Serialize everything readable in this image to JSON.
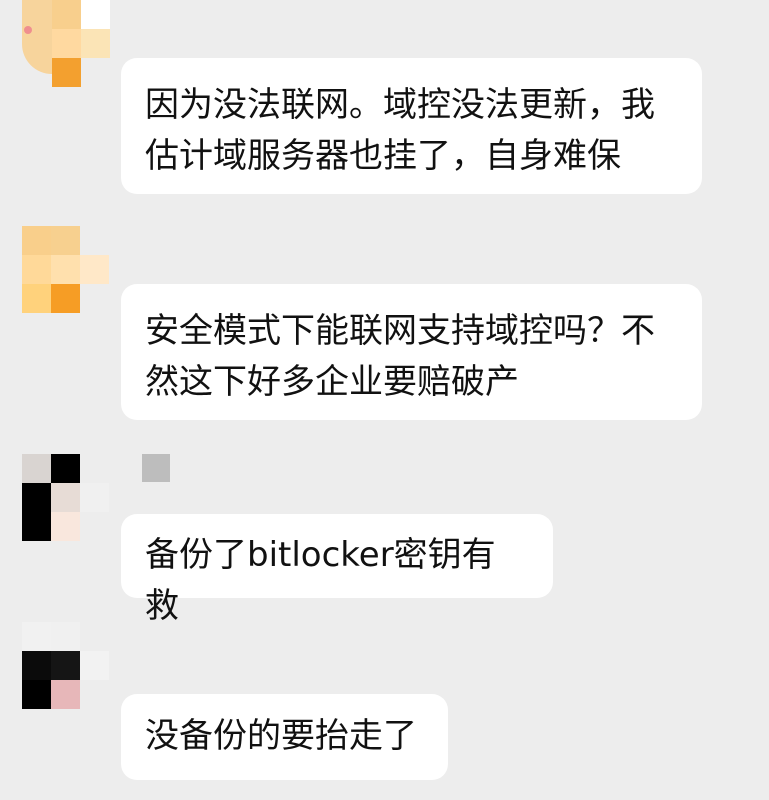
{
  "messages": [
    {
      "text": "因为没法联网。域控没法更新，我估计域服务器也挂了，自身难保"
    },
    {
      "text": "安全模式下能联网支持域控吗？不然这下好多企业要赔破产"
    },
    {
      "text": "备份了bitlocker密钥有救"
    },
    {
      "text": "没备份的要抬走了"
    }
  ],
  "colors": {
    "background": "#ededed",
    "bubble": "#ffffff",
    "text": "#111111"
  },
  "icons": {
    "avatar1": "avatar-icon",
    "avatar2": "avatar-icon",
    "avatar3": "avatar-icon",
    "avatar4": "avatar-icon"
  }
}
